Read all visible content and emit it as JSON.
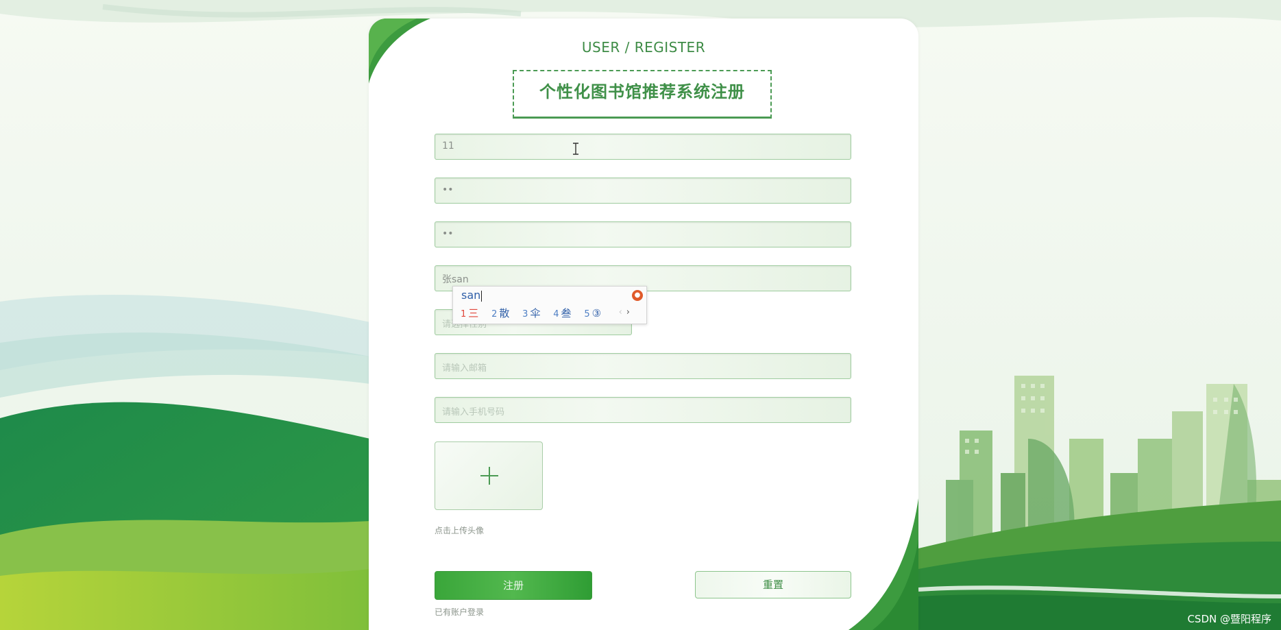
{
  "header": {
    "subtitle": "USER / REGISTER",
    "title": "个性化图书馆推荐系统注册"
  },
  "form": {
    "fields": [
      {
        "value": "11",
        "placeholder": ""
      },
      {
        "value": "••",
        "placeholder": ""
      },
      {
        "value": "••",
        "placeholder": ""
      },
      {
        "value": "张san",
        "placeholder": ""
      },
      {
        "value": "",
        "placeholder": "请选择性别"
      },
      {
        "value": "",
        "placeholder": "请输入邮箱"
      },
      {
        "value": "",
        "placeholder": "请输入手机号码"
      }
    ],
    "upload_hint": "点击上传头像",
    "register_label": "注册",
    "reset_label": "重置",
    "login_link": "已有账户登录"
  },
  "ime": {
    "input": "san",
    "candidates": [
      {
        "num": "1",
        "text": "三"
      },
      {
        "num": "2",
        "text": "散"
      },
      {
        "num": "3",
        "text": "伞"
      },
      {
        "num": "4",
        "text": "叁"
      },
      {
        "num": "5",
        "text": "③"
      }
    ],
    "prev": "‹",
    "next": "›"
  },
  "watermark": "CSDN @暨阳程序",
  "colors": {
    "brand_green": "#3f9048",
    "button_green": "#3aa63a"
  }
}
